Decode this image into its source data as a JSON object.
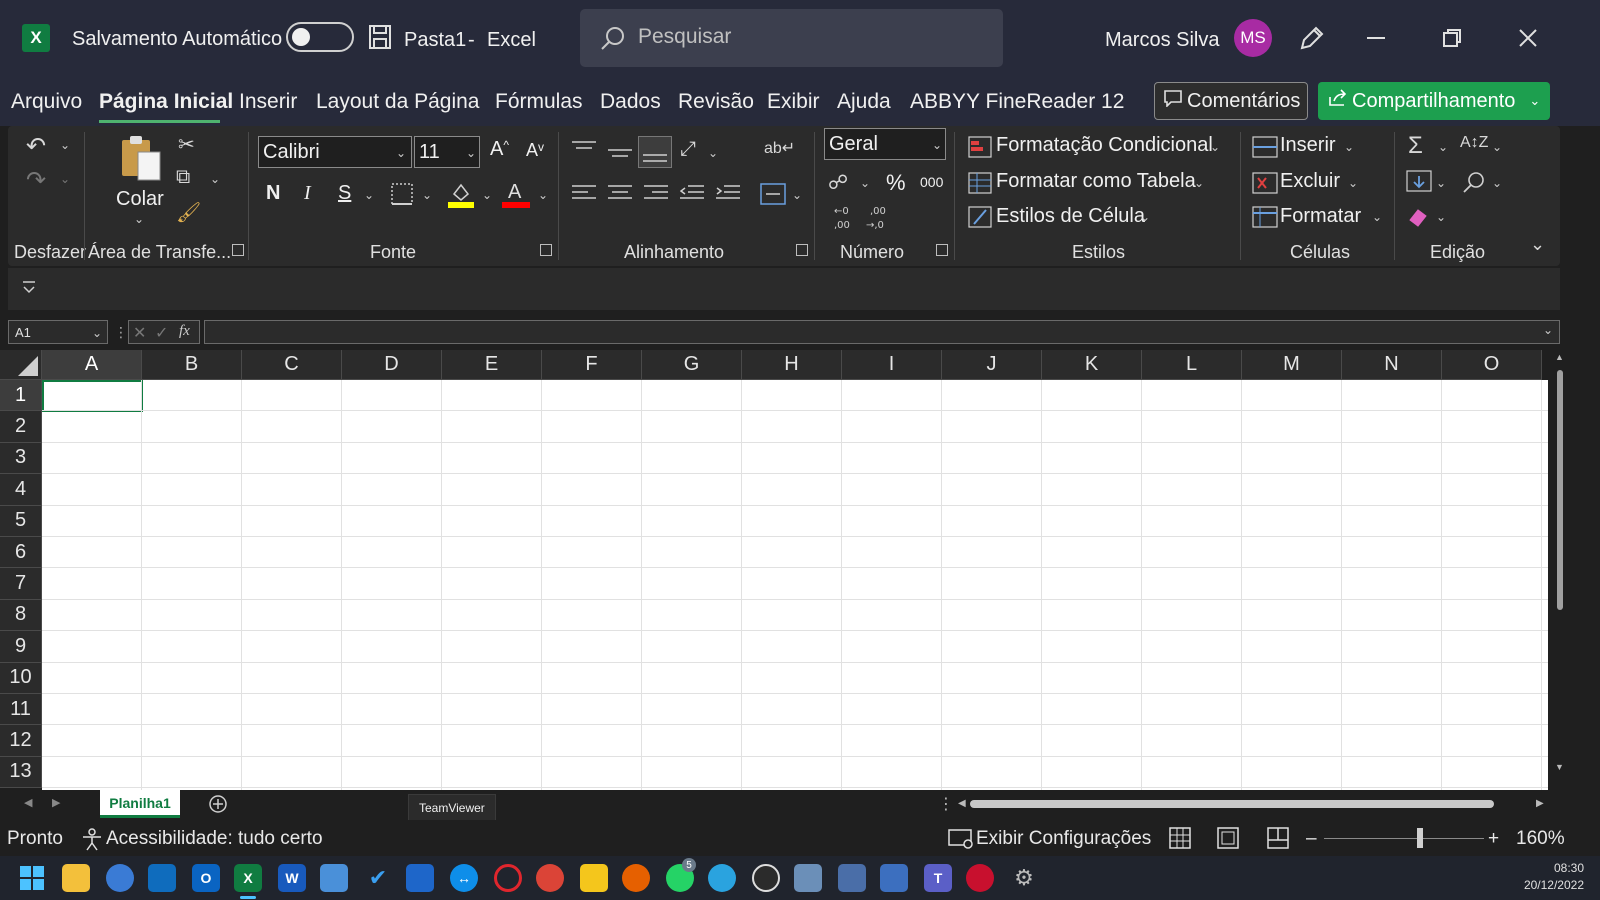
{
  "titlebar": {
    "logo": "X",
    "autosave_label": "Salvamento Automático",
    "file_name": "Pasta1",
    "separator": "-",
    "app_name": "Excel",
    "search_placeholder": "Pesquisar",
    "user_name": "Marcos Silva",
    "user_initials": "MS"
  },
  "menu": {
    "items": [
      "Arquivo",
      "Página Inicial",
      "Inserir",
      "Layout da Página",
      "Fórmulas",
      "Dados",
      "Revisão",
      "Exibir",
      "Ajuda",
      "ABBYY FineReader 12"
    ],
    "active": "Página Inicial",
    "comments_label": "Comentários",
    "share_label": "Compartilhamento"
  },
  "ribbon": {
    "undo": {
      "label": "Desfazer"
    },
    "clipboard": {
      "label": "Área de Transfe...",
      "paste_label": "Colar"
    },
    "font": {
      "label": "Fonte",
      "font_name": "Calibri",
      "font_size": "11",
      "bold": "N",
      "italic": "I",
      "underline": "S",
      "fill_color": "#ffff00",
      "font_color": "#ff0000"
    },
    "alignment": {
      "label": "Alinhamento"
    },
    "number": {
      "label": "Número",
      "format": "Geral",
      "percent": "%",
      "thousands": "000"
    },
    "styles": {
      "label": "Estilos",
      "conditional": "Formatação Condicional",
      "as_table": "Formatar como Tabela",
      "cell_styles": "Estilos de Célula"
    },
    "cells": {
      "label": "Células",
      "insert": "Inserir",
      "delete": "Excluir",
      "format": "Formatar"
    },
    "editing": {
      "label": "Edição"
    }
  },
  "formula_bar": {
    "name_box": "A1",
    "fx": "fx",
    "value": ""
  },
  "grid": {
    "columns": [
      "A",
      "B",
      "C",
      "D",
      "E",
      "F",
      "G",
      "H",
      "I",
      "J",
      "K",
      "L",
      "M",
      "N",
      "O"
    ],
    "rows": [
      "1",
      "2",
      "3",
      "4",
      "5",
      "6",
      "7",
      "8",
      "9",
      "10",
      "11",
      "12",
      "13"
    ],
    "active_cell": "A1"
  },
  "sheets": {
    "tabs": [
      "Planilha1"
    ]
  },
  "status": {
    "ready": "Pronto",
    "accessibility": "Acessibilidade: tudo certo",
    "tooltip": "TeamViewer",
    "display_settings": "Exibir Configurações",
    "zoom_minus": "–",
    "zoom_plus": "+",
    "zoom": "160%"
  },
  "taskbar": {
    "time": "08:30",
    "date": "20/12/2022",
    "whatsapp_badge": "5"
  },
  "colors": {
    "excel_green": "#107c41",
    "share_green": "#1d9f4f",
    "avatar": "#a82ba3"
  }
}
